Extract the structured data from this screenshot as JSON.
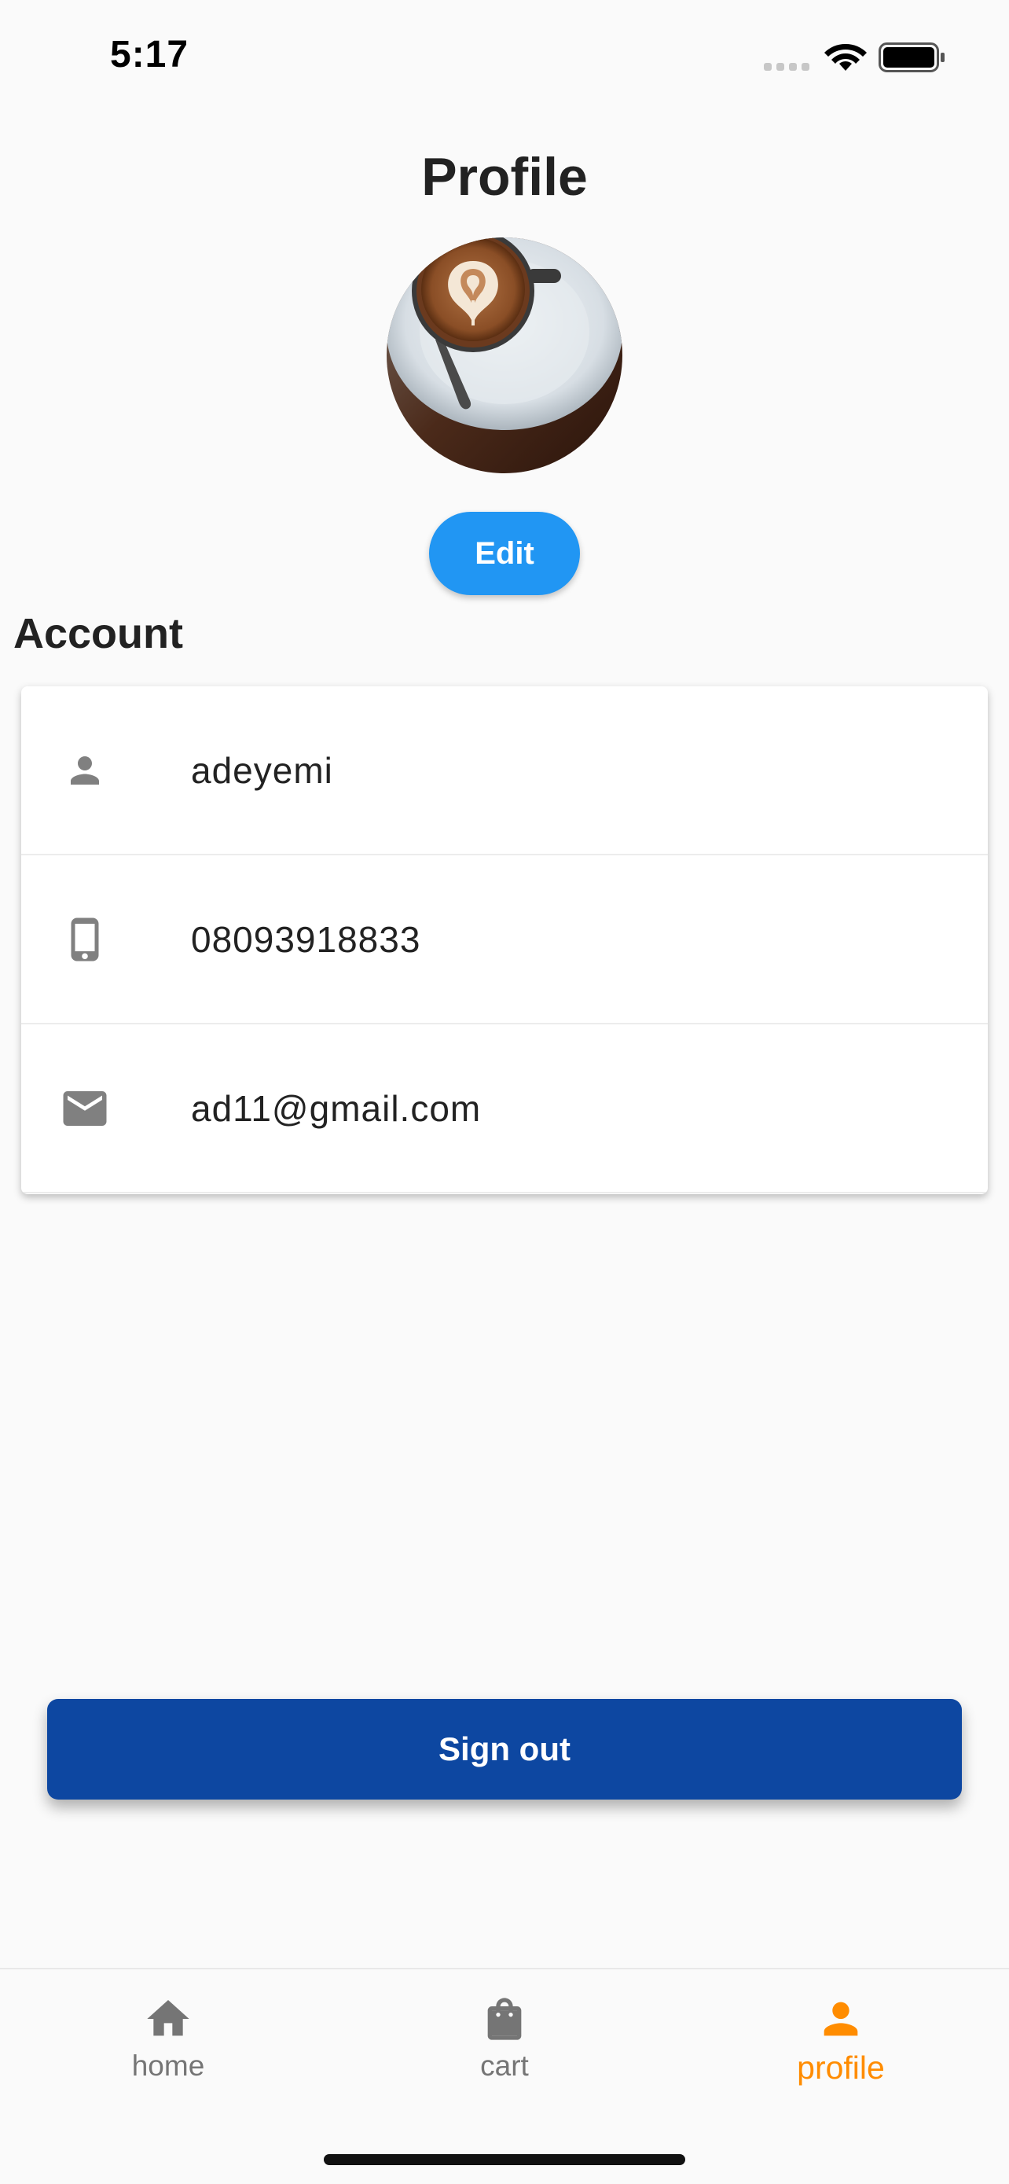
{
  "status_bar": {
    "time": "5:17"
  },
  "page": {
    "title": "Profile"
  },
  "profile": {
    "edit_label": "Edit",
    "section_heading": "Account",
    "fields": [
      {
        "icon": "person-icon",
        "value": "adeyemi"
      },
      {
        "icon": "phone-icon",
        "value": "08093918833"
      },
      {
        "icon": "mail-icon",
        "value": "ad11@gmail.com"
      }
    ],
    "signout_label": "Sign out"
  },
  "bottom_nav": {
    "items": [
      {
        "label": "home",
        "icon": "home-icon",
        "active": false
      },
      {
        "label": "cart",
        "icon": "shopping-bag-icon",
        "active": false
      },
      {
        "label": "profile",
        "icon": "person-icon",
        "active": true
      }
    ]
  },
  "colors": {
    "primary_button": "#2196f3",
    "signout_button": "#0d47a1",
    "active_nav": "#ff8c00",
    "inactive_nav": "#757575",
    "row_icon": "#808080"
  }
}
